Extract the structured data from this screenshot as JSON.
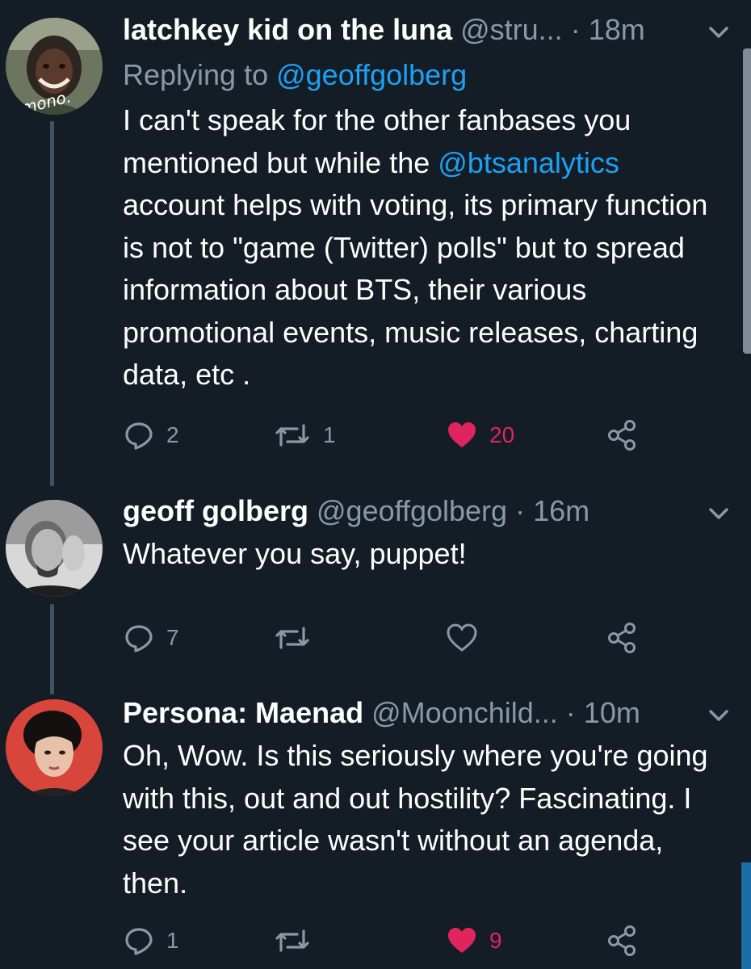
{
  "tweets": [
    {
      "name": "latchkey kid on the luna",
      "handle": "@stru...",
      "time": "18m",
      "replying_prefix": "Replying to ",
      "replying_handle": "@geoffgolberg",
      "body_part1": "I can't speak for the other fanbases you mentioned but while the ",
      "body_mention": "@btsanalytics",
      "body_part2": " account helps with voting, its primary function is not to \"game (Twitter) polls\" but to spread information about BTS, their various promotional events, music releases, charting data, etc .",
      "avatar_text": "mono.",
      "replies": "2",
      "retweets": "1",
      "likes": "20",
      "liked": true
    },
    {
      "name": "geoff golberg",
      "handle": "@geoffgolberg",
      "time": "16m",
      "body": "Whatever you say, puppet!",
      "replies": "7",
      "retweets": "",
      "likes": "",
      "liked": false
    },
    {
      "name": "Persona: Maenad",
      "handle": "@Moonchild...",
      "time": "10m",
      "body": "Oh, Wow. Is this seriously where you're going with this, out and out hostility? Fascinating. I see your article wasn't without an agenda, then.",
      "replies": "1",
      "retweets": "",
      "likes": "9",
      "liked": true
    }
  ],
  "colors": {
    "background": "#141d26",
    "secondary_text": "#8899a6",
    "link": "#1da1f2",
    "like": "#e0245e"
  },
  "icons": [
    "reply-icon",
    "retweet-icon",
    "like-icon",
    "share-icon",
    "chevron-down-icon"
  ]
}
